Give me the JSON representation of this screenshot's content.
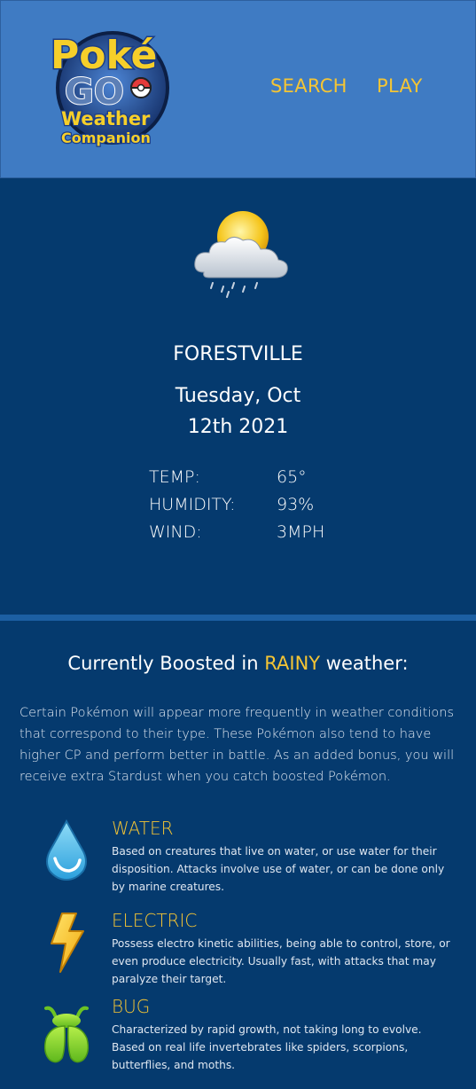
{
  "header": {
    "logo_text": [
      "Poké",
      "GO",
      "Weather",
      "Companion"
    ],
    "nav": {
      "search_label": "SEARCH",
      "play_label": "PLAY"
    }
  },
  "weather": {
    "icon": "partly-cloudy-rain-icon",
    "city": "FORESTVILLE",
    "date_line1": "Tuesday, Oct",
    "date_line2": "12th 2021",
    "stats": [
      {
        "label": "TEMP:",
        "value": "65°"
      },
      {
        "label": "HUMIDITY:",
        "value": "93%"
      },
      {
        "label": "WIND:",
        "value": "3MPH"
      }
    ]
  },
  "boost": {
    "title_prefix": "Currently Boosted in ",
    "condition": "RAINY",
    "title_suffix": " weather:",
    "description": "Certain Pokémon will appear more frequently in weather conditions that correspond to their type. These Pokémon also tend to have higher CP and perform better in battle. As an added bonus, you will receive extra Stardust when you catch boosted Pokémon.",
    "types": [
      {
        "name": "WATER",
        "icon": "water-drop-icon",
        "description": "Based on creatures that live on water, or use water for their disposition. Attacks involve use of water, or can be done only by marine creatures."
      },
      {
        "name": "ELECTRIC",
        "icon": "lightning-bolt-icon",
        "description": "Possess electro kinetic abilities, being able to control, store, or even produce electricity. Usually fast, with attacks that may paralyze their target."
      },
      {
        "name": "BUG",
        "icon": "bug-icon",
        "description": "Characterized by rapid growth, not taking long to evolve. Based on real life invertebrates like spiders, scorpions, butterflies, and moths."
      }
    ]
  },
  "colors": {
    "header_bg": "#3f7bc3",
    "page_bg": "#053a6e",
    "accent": "#f5c534",
    "divider": "#1c5fa3"
  }
}
